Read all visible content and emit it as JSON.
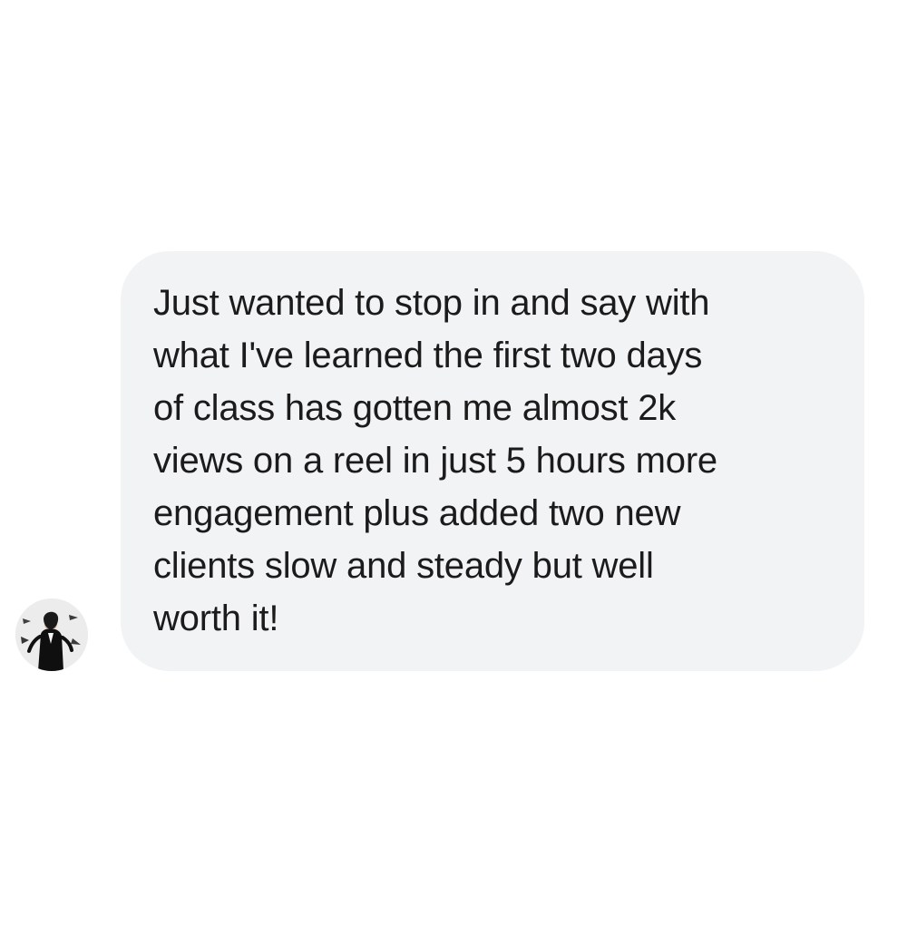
{
  "conversation": {
    "incoming_message": {
      "sender_avatar_icon": "profile-photo-avatar",
      "bubble_color": "#f2f3f5",
      "text_color": "#1b1b1b",
      "text": "Just wanted to stop in and say with\nwhat I've learned the first two days\nof class has gotten me almost 2k\nviews on a reel in just 5 hours more\nengagement plus added two new\nclients slow and steady but well\nworth it!"
    }
  }
}
